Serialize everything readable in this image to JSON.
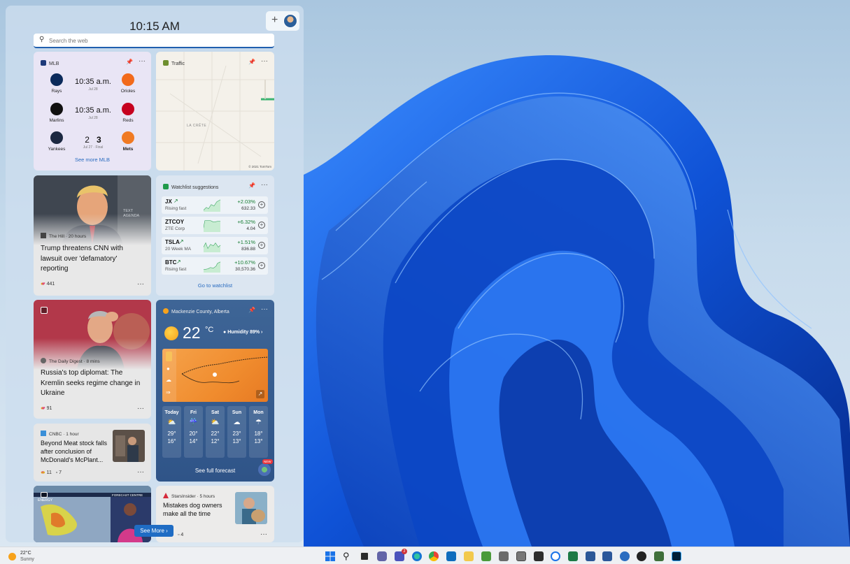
{
  "clock": "10:15 AM",
  "search": {
    "placeholder": "Search the web"
  },
  "mlb": {
    "title": "MLB",
    "games": [
      {
        "away": "Rays",
        "home": "Orioles",
        "time": "10:35 a.m.",
        "date": "Jul 28"
      },
      {
        "away": "Marlins",
        "home": "Reds",
        "time": "10:35 a.m.",
        "date": "Jul 28"
      },
      {
        "away": "Yankees",
        "home": "Mets",
        "away_score": "2",
        "home_score": "3",
        "date": "Jul 27 · Final"
      }
    ],
    "more": "See more MLB"
  },
  "traffic": {
    "title": "Traffic",
    "map_label": "LA CRÊTE",
    "copyright": "© 2021 TomTom"
  },
  "news1": {
    "source": "The Hill · 20 hours",
    "headline_l1": "Trump threatens CNN with",
    "headline_l2": "lawsuit over 'defamatory'",
    "headline_l3": "reporting",
    "reactions": "441",
    "img_text": "TEXT AGENDA"
  },
  "watchlist": {
    "title": "Watchlist suggestions",
    "stocks": [
      {
        "symbol": "JX",
        "sub": "Rising fast",
        "change": "+2.03%",
        "price": "632.33"
      },
      {
        "symbol": "ZTCOY",
        "sub": "ZTE Corp",
        "change": "+6.32%",
        "price": "4.04"
      },
      {
        "symbol": "TSLA",
        "sub": "20 Week MA",
        "change": "+1.51%",
        "price": "836.88"
      },
      {
        "symbol": "BTC",
        "sub": "Rising fast",
        "change": "+10.67%",
        "price": "30,570.36"
      }
    ],
    "link": "Go to watchlist"
  },
  "news2": {
    "source": "The Daily Digest · 8 mins",
    "headline_l1": "Russia's top diplomat: The",
    "headline_l2": "Kremlin seeks regime change in",
    "headline_l3": "Ukraine",
    "reactions": "91"
  },
  "weather": {
    "location": "Mackenzie County, Alberta",
    "temp": "22",
    "unit": "°C",
    "humidity": "Humidity 89%",
    "days": [
      {
        "name": "Today",
        "icon": "partly-sunny",
        "hi": "29°",
        "lo": "16°"
      },
      {
        "name": "Fri",
        "icon": "sun-rain",
        "hi": "20°",
        "lo": "14°"
      },
      {
        "name": "Sat",
        "icon": "partly-sunny",
        "hi": "22°",
        "lo": "12°"
      },
      {
        "name": "Sun",
        "icon": "cloudy",
        "hi": "23°",
        "lo": "13°"
      },
      {
        "name": "Mon",
        "icon": "rain",
        "hi": "18°",
        "lo": "13°"
      }
    ],
    "link": "See full forecast",
    "badge": "NEW"
  },
  "news3": {
    "source": "CNBC · 1 hour",
    "headline_l1": "Beyond Meat stock falls",
    "headline_l2": "after conclusion of",
    "headline_l3": "McDonald's McPlant...",
    "reactions": "11",
    "comments": "7"
  },
  "news4": {
    "img_label_left": "ENERGY",
    "img_label_right": "FORECAST CENTRE"
  },
  "news5": {
    "source": "StarsInsider · 5 hours",
    "headline_l1": "Mistakes dog owners",
    "headline_l2": "make all the time",
    "reactions": "49",
    "comments": "4"
  },
  "see_more": "See More",
  "taskbar": {
    "weather_temp": "22°C",
    "weather_cond": "Sunny",
    "chat_badge": "2"
  },
  "colors": {
    "accent": "#1f6cc4",
    "positive": "#127a2f",
    "weather_card": "#3e6596"
  }
}
